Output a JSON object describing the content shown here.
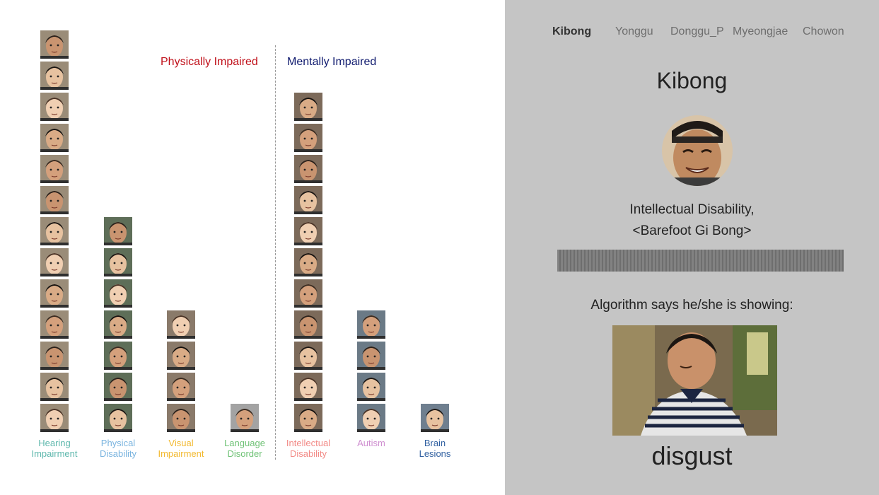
{
  "groups": {
    "physical_title": "Physically Impaired",
    "physical_color": "#c0101a",
    "mental_title": "Mentally Impaired",
    "mental_color": "#0f1a6e"
  },
  "categories": [
    {
      "name": "Hearing\nImpairment",
      "color": "#5fb8ad",
      "count": 13
    },
    {
      "name": "Physical\nDisability",
      "color": "#7ab4df",
      "count": 7
    },
    {
      "name": "Visual\nImpairment",
      "color": "#f2b92f",
      "count": 4
    },
    {
      "name": "Language\nDisorder",
      "color": "#6fc276",
      "count": 1
    },
    {
      "name": "Intellectual\nDisability",
      "color": "#f28a86",
      "count": 11
    },
    {
      "name": "Autism",
      "color": "#cf8fd0",
      "count": 4
    },
    {
      "name": "Brain\nLesions",
      "color": "#2f5fa0",
      "count": 1
    }
  ],
  "tabs": [
    "Kibong",
    "Yonggu",
    "Donggu_P",
    "Myeongjae",
    "Chowon"
  ],
  "active_tab": 0,
  "character": {
    "name": "Kibong",
    "disability": "Intellectual Disability,",
    "title": "<Barefoot Gi Bong>"
  },
  "algorithm_text": "Algorithm says he/she is showing:",
  "emotion": "disgust"
}
